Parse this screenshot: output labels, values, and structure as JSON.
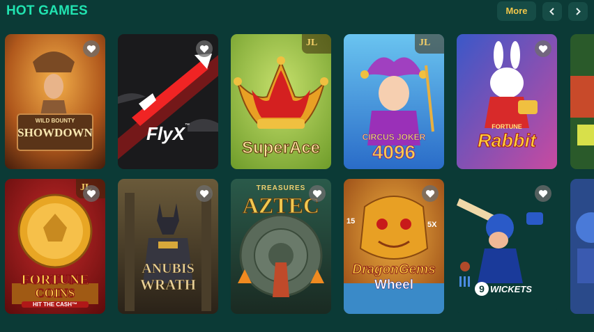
{
  "header": {
    "title": "HOT GAMES",
    "more_label": "More"
  },
  "colors": {
    "background": "#0b3a36",
    "title": "#21e3b0",
    "more_text": "#f1c64a",
    "button_bg": "#164c46"
  },
  "games": [
    {
      "name": "Wild Bounty Showdown",
      "logo_top": "WILD BOUNTY",
      "logo_main": "SHOWDOWN",
      "favorite": true,
      "badge": ""
    },
    {
      "name": "FlyX",
      "logo_main": "FlyX",
      "logo_tm": "™",
      "favorite": true,
      "badge": ""
    },
    {
      "name": "Super Ace",
      "logo_main": "SuperAce",
      "favorite": false,
      "badge": "JL"
    },
    {
      "name": "Circus Joker 4096",
      "logo_top": "CIRCUS JOKER",
      "logo_main": "4096",
      "favorite": false,
      "badge": "JL"
    },
    {
      "name": "Fortune Rabbit",
      "logo_top": "FORTUNE",
      "logo_main": "Rabbit",
      "favorite": true,
      "badge": ""
    },
    {
      "name": "Fortune Coins",
      "logo_top": "FORTUNE",
      "logo_main": "COINS",
      "logo_sub": "HIT THE CASH™",
      "favorite": true,
      "badge": "JL"
    },
    {
      "name": "Anubis Wrath",
      "logo_top": "ANUBIS",
      "logo_main": "WRATH",
      "favorite": true,
      "badge": ""
    },
    {
      "name": "Treasures of Aztec",
      "logo_top": "TREASURES",
      "logo_main": "AZTEC",
      "favorite": true,
      "badge": ""
    },
    {
      "name": "Dragon Gems Wheel",
      "logo_top": "DragonGems",
      "logo_main": "Wheel",
      "logo_left": "15",
      "logo_right": "5X",
      "favorite": true,
      "badge": ""
    },
    {
      "name": "9 Wickets",
      "logo_main": "WICKETS",
      "logo_num": "9",
      "favorite": true,
      "badge": ""
    }
  ]
}
